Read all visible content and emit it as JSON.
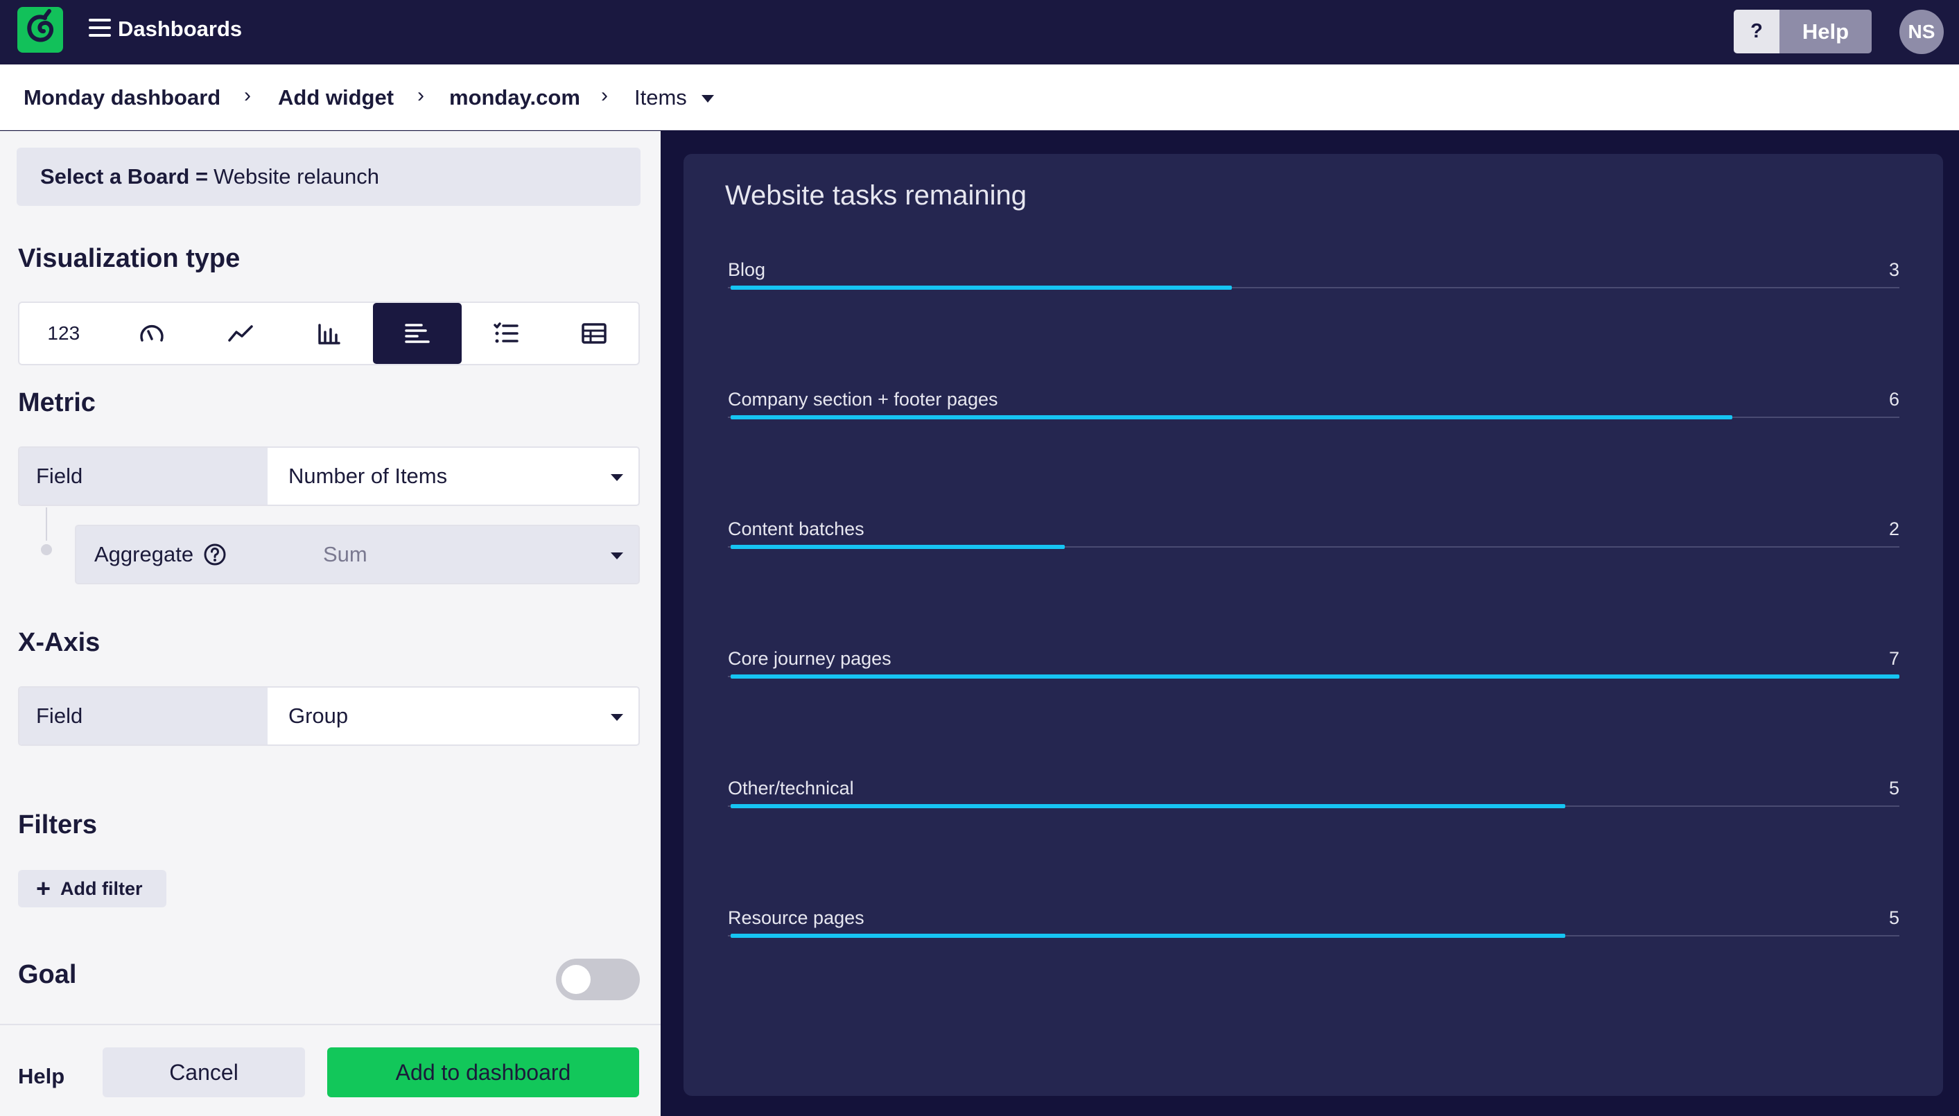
{
  "topbar": {
    "app_title": "Dashboards",
    "help_q": "?",
    "help_label": "Help",
    "avatar_initials": "NS"
  },
  "breadcrumb": {
    "items": [
      "Monday dashboard",
      "Add widget",
      "monday.com"
    ],
    "current": "Items",
    "separator": "›"
  },
  "left_panel": {
    "board_filter": {
      "key": "Select a Board =",
      "value": "Website relaunch"
    },
    "viz_type": {
      "title": "Visualization type",
      "options": [
        {
          "icon": "number-icon",
          "label": "123"
        },
        {
          "icon": "gauge-icon"
        },
        {
          "icon": "line-chart-icon"
        },
        {
          "icon": "column-chart-icon"
        },
        {
          "icon": "bar-chart-icon",
          "active": true
        },
        {
          "icon": "list-icon"
        },
        {
          "icon": "table-icon"
        }
      ]
    },
    "metric": {
      "title": "Metric",
      "field_label": "Field",
      "field_value": "Number of Items",
      "aggregate_label": "Aggregate",
      "aggregate_value": "Sum"
    },
    "xaxis": {
      "title": "X-Axis",
      "field_label": "Field",
      "field_value": "Group"
    },
    "filters": {
      "title": "Filters",
      "add_filter": "Add filter"
    },
    "goal": {
      "title": "Goal",
      "enabled": false
    },
    "footer": {
      "help": "Help",
      "cancel": "Cancel",
      "add": "Add to dashboard"
    }
  },
  "colors": {
    "accent_green": "#12c75a",
    "bar": "#16c4f2",
    "topbar": "#1a1840",
    "chart_bg": "#252650"
  },
  "chart_data": {
    "type": "bar",
    "title": "Website tasks remaining",
    "categories": [
      "Blog",
      "Company section + footer pages",
      "Content batches",
      "Core journey pages",
      "Other/technical",
      "Resource pages"
    ],
    "values": [
      3,
      6,
      2,
      7,
      5,
      5
    ],
    "xlim": [
      0,
      7
    ],
    "orientation": "horizontal"
  }
}
